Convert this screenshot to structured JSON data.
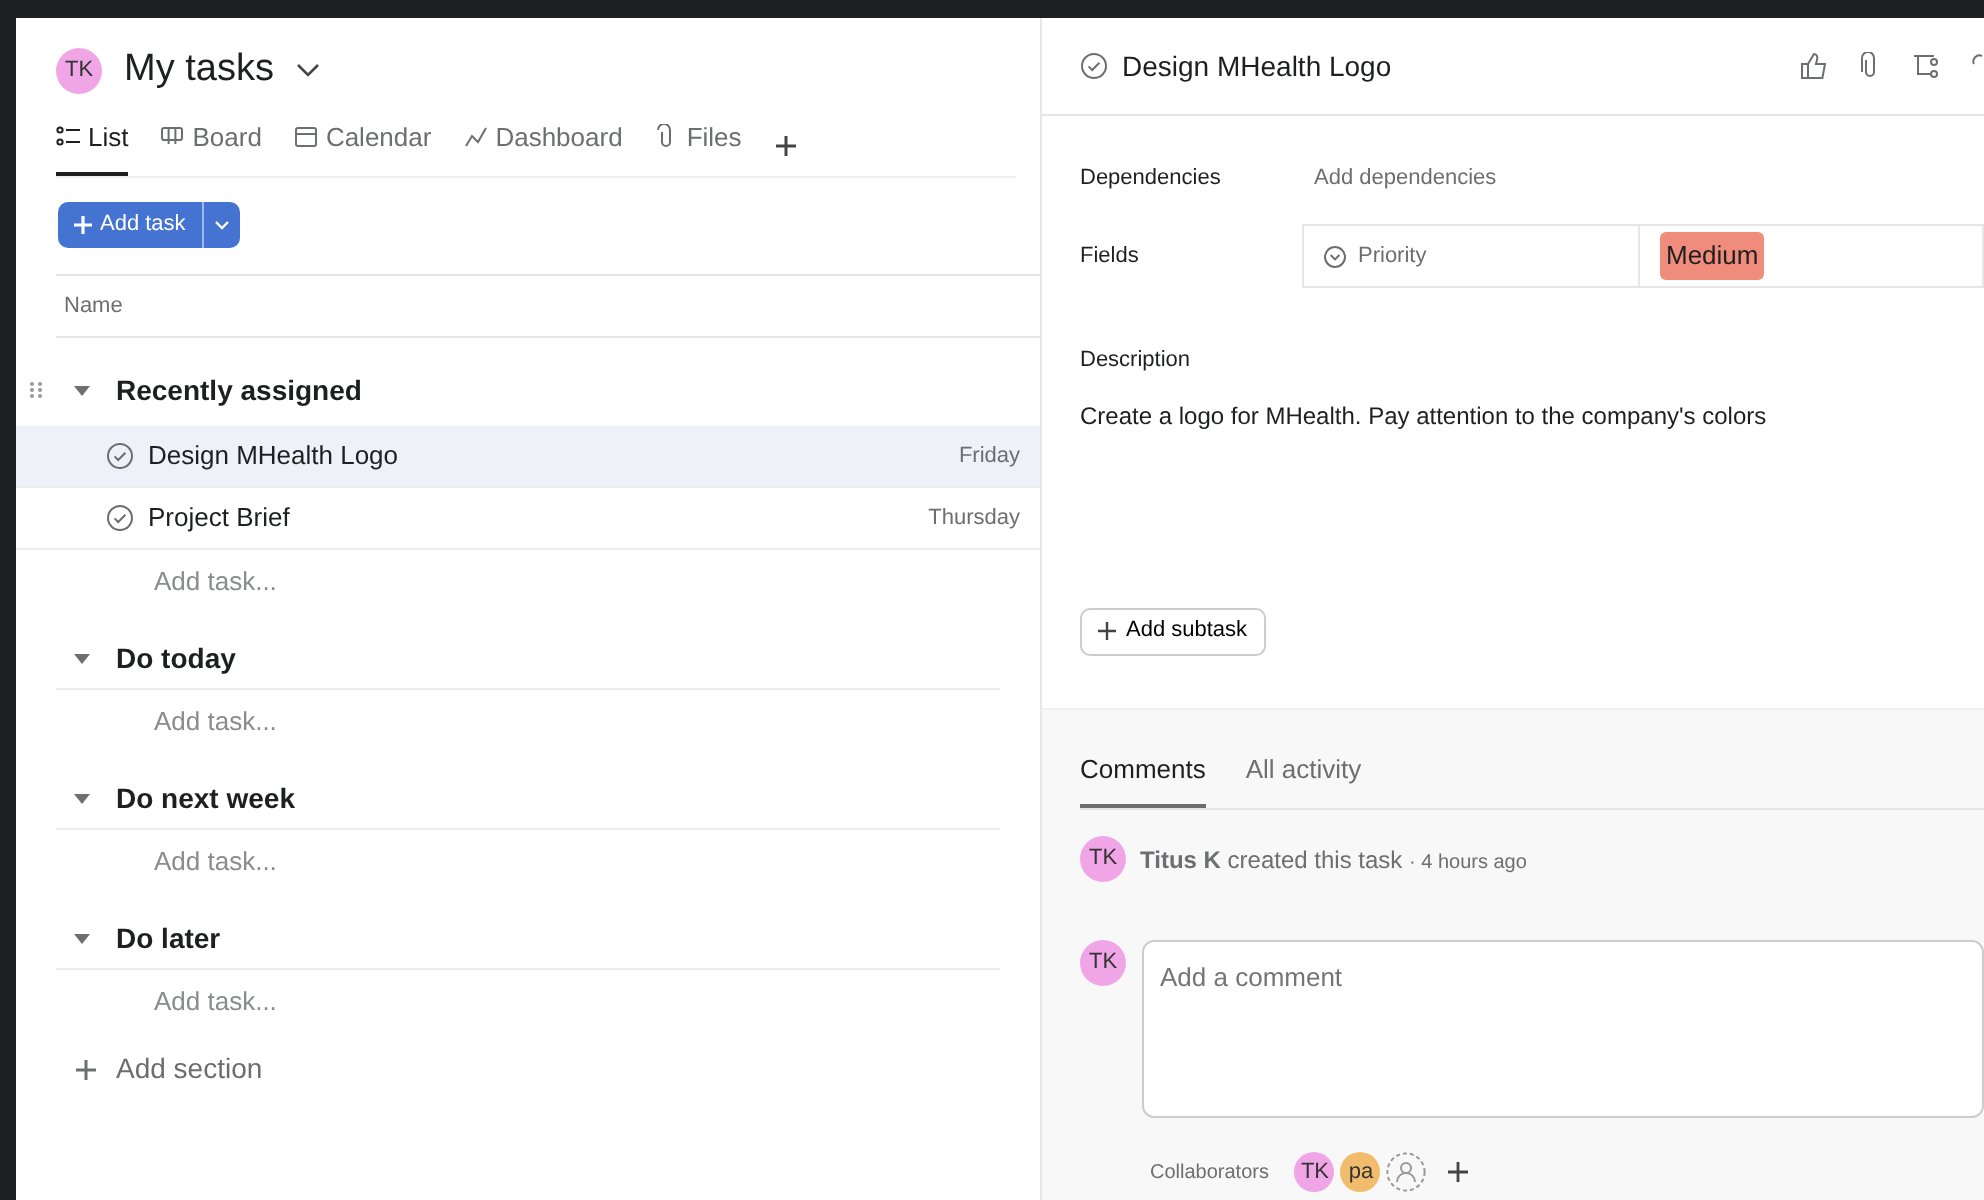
{
  "header": {
    "avatar": "TK",
    "title": "My tasks"
  },
  "view_tabs": [
    {
      "label": "List",
      "selected": true
    },
    {
      "label": "Board",
      "selected": false
    },
    {
      "label": "Calendar",
      "selected": false
    },
    {
      "label": "Dashboard",
      "selected": false
    },
    {
      "label": "Files",
      "selected": false
    }
  ],
  "add_task_button": "Add task",
  "columns": [
    "Name"
  ],
  "sections": [
    {
      "title": "Recently assigned",
      "expanded": true,
      "tasks": [
        {
          "name": "Design MHealth Logo",
          "due": "Friday",
          "selected": true
        },
        {
          "name": "Project Brief",
          "due": "Thursday",
          "selected": false
        }
      ],
      "add_task": "Add task..."
    },
    {
      "title": "Do today",
      "expanded": true,
      "add_task": "Add task..."
    },
    {
      "title": "Do next week",
      "expanded": true,
      "add_task": "Add task..."
    },
    {
      "title": "Do later",
      "expanded": true,
      "add_task": "Add task..."
    }
  ],
  "add_section": "Add section",
  "detail": {
    "title": "Design MHealth Logo",
    "fields": [
      {
        "kind": "link",
        "label": "Dependencies",
        "value": "Add dependencies"
      },
      {
        "kind": "custom",
        "label": "Fields",
        "name": "Priority",
        "value": "Medium",
        "color": "#ef8c7b"
      }
    ],
    "description_label": "Description",
    "description": "Create a logo for MHealth. Pay attention to the company's colors",
    "add_subtask": "Add subtask",
    "activity_tabs": [
      {
        "label": "Comments",
        "selected": true
      },
      {
        "label": "All activity",
        "selected": false
      }
    ],
    "activity": [
      {
        "avatar": "TK",
        "author": "Titus K",
        "action": "created this task",
        "time": "· 4 hours ago"
      }
    ],
    "comment": {
      "avatar": "TK",
      "placeholder": "Add a comment"
    },
    "collaborators_label": "Collaborators",
    "collaborators": [
      {
        "initials": "TK",
        "color": "#f0a6e6"
      },
      {
        "initials": "pa",
        "color": "#f1bd6c"
      }
    ]
  }
}
